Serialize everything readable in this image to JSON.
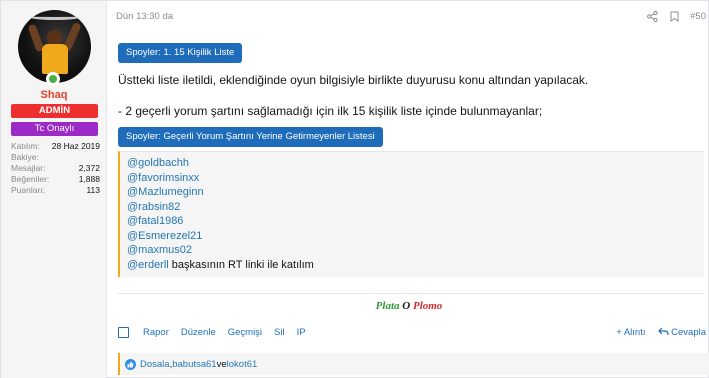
{
  "user": {
    "name": "Shaq",
    "badges": {
      "admin": "ADMİN",
      "tc": "Tc Onaylı"
    },
    "stats": [
      {
        "key": "Katılım:",
        "value": "28 Haz 2019"
      },
      {
        "key": "Bakiye:",
        "value": ""
      },
      {
        "key": "Mesajlar:",
        "value": "2,372"
      },
      {
        "key": "Beğeniler:",
        "value": "1,888"
      },
      {
        "key": "Puanları:",
        "value": "113"
      }
    ]
  },
  "post": {
    "timestamp": "Dün 13:30 da",
    "number": "#50",
    "spoiler1": "Spoyler: 1. 15 Kişilik Liste",
    "line1": "Üstteki liste iletildi, eklendiğinde oyun bilgisiyle birlikte duyurusu konu altından yapılacak.",
    "line2": "- 2 geçerli yorum şartını sağlamadığı için ilk 15 kişilik liste içinde bulunmayanlar;",
    "spoiler2": "Spoyler: Geçerli Yorum Şartını Yerine Getirmeyenler Listesi",
    "mentions": [
      {
        "handle": "@goldbachh",
        "tail": ""
      },
      {
        "handle": "@favorimsinxx",
        "tail": ""
      },
      {
        "handle": "@Mazlumeginn",
        "tail": ""
      },
      {
        "handle": "@rabsin82",
        "tail": ""
      },
      {
        "handle": "@fatal1986",
        "tail": ""
      },
      {
        "handle": "@Esmerezel21",
        "tail": ""
      },
      {
        "handle": "@maxmus02",
        "tail": ""
      },
      {
        "handle": "@erderll",
        "tail": " başkasının RT linki ile katılım"
      }
    ]
  },
  "signature": {
    "part1": "Plata ",
    "part2": "O",
    "part3": " Plomo"
  },
  "actions": {
    "left": [
      "Rapor",
      "Düzenle",
      "Geçmişi",
      "Sil",
      "IP"
    ],
    "quote": "+ Alıntı",
    "reply": "Cevapla"
  },
  "reactions": {
    "names": [
      "Dosala",
      "babutsa61"
    ],
    "separator": ", ",
    "conj": " ve ",
    "last": "lokot61"
  },
  "icons": {
    "share": "share-icon",
    "bookmark": "bookmark-icon",
    "like": "like-icon",
    "reply": "reply-icon",
    "checkbox": "checkbox-icon"
  },
  "colors": {
    "accent": "#1f6dba",
    "admin": "#ed2f2f",
    "tc": "#9b2ac7",
    "username": "#e2442d",
    "spoiler_border": "#f0a91c"
  }
}
